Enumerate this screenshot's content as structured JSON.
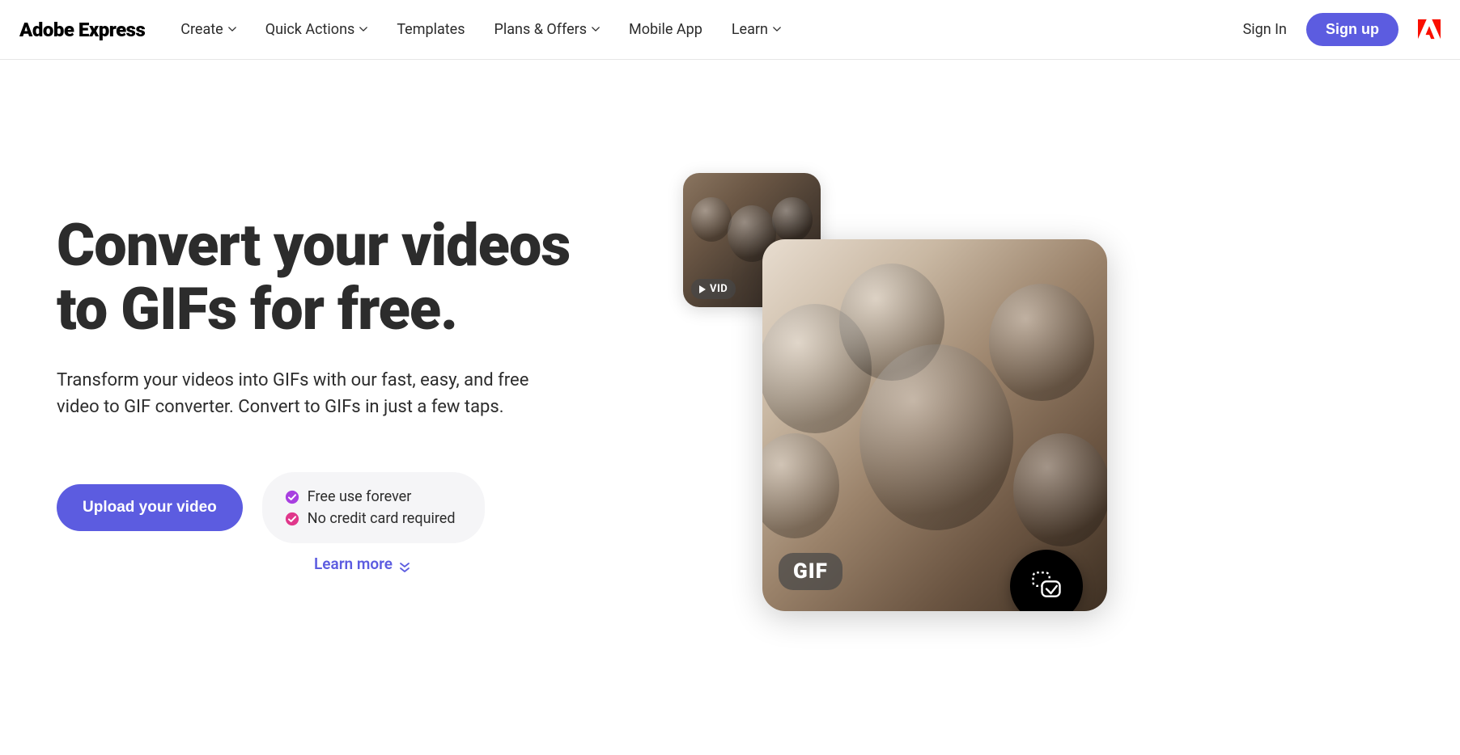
{
  "header": {
    "logo": "Adobe Express",
    "nav": {
      "create": "Create",
      "quick_actions": "Quick Actions",
      "templates": "Templates",
      "plans": "Plans & Offers",
      "mobile_app": "Mobile App",
      "learn": "Learn"
    },
    "sign_in": "Sign In",
    "sign_up": "Sign up"
  },
  "hero": {
    "title": "Convert your videos to GIFs for free.",
    "description": "Transform your videos into GIFs with our fast, easy, and free video to GIF converter. Convert to GIFs in just a few taps.",
    "upload_label": "Upload your video",
    "benefit1": "Free use forever",
    "benefit2": "No credit card required",
    "learn_more": "Learn more",
    "vid_badge": "VID",
    "gif_badge": "GIF"
  },
  "colors": {
    "accent": "#5c5ce0",
    "check_purple": "#a83fe0",
    "check_pink": "#e0378b",
    "adobe_red": "#fa0f00"
  }
}
